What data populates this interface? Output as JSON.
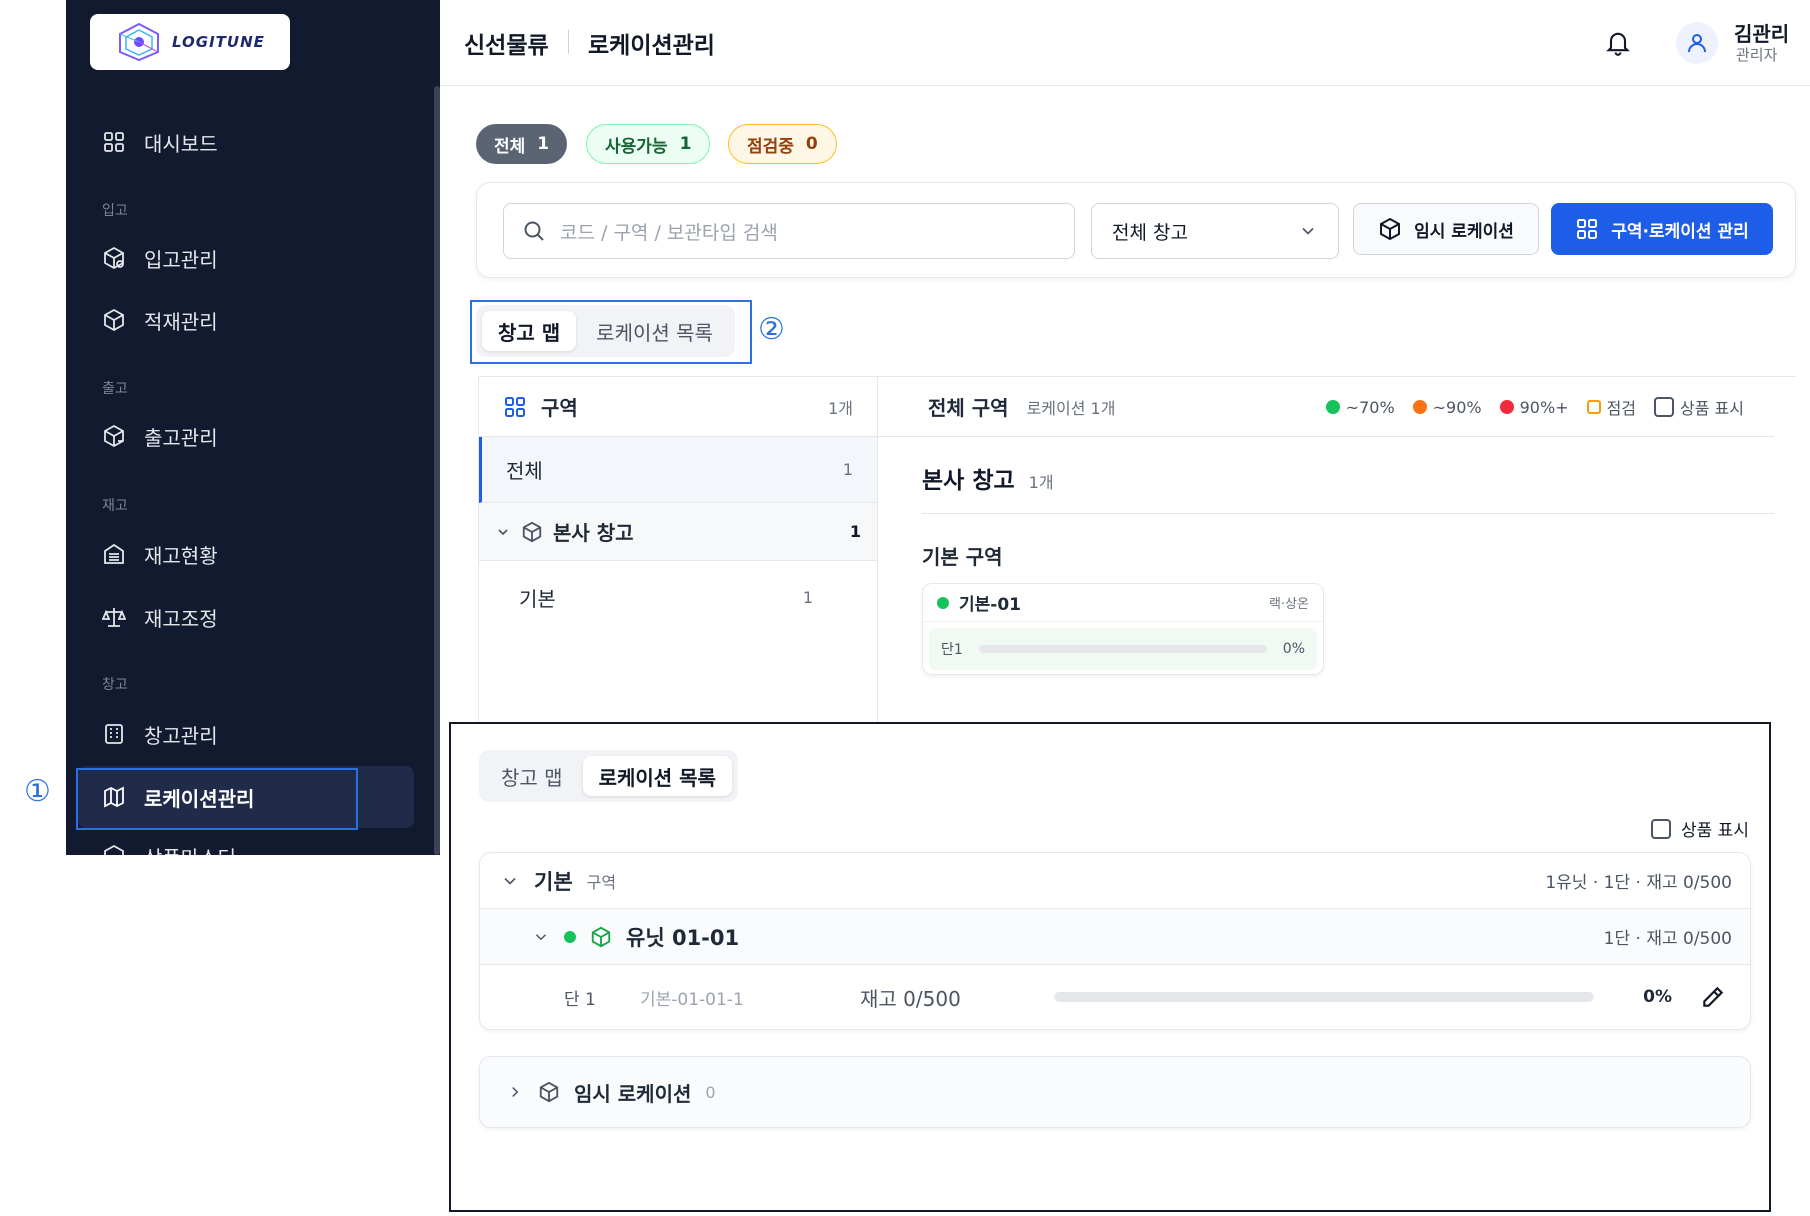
{
  "sidebar": {
    "logo_text": "LOGITUNE",
    "items": [
      {
        "label": "대시보드",
        "icon": "grid-icon"
      },
      {
        "group": "입고"
      },
      {
        "label": "입고관리",
        "icon": "box-in-icon"
      },
      {
        "label": "적재관리",
        "icon": "box-icon"
      },
      {
        "group": "출고"
      },
      {
        "label": "출고관리",
        "icon": "box-out-icon"
      },
      {
        "group": "재고"
      },
      {
        "label": "재고현황",
        "icon": "warehouse-icon"
      },
      {
        "label": "재고조정",
        "icon": "scale-icon"
      },
      {
        "group": "창고"
      },
      {
        "label": "창고관리",
        "icon": "building-icon"
      },
      {
        "label": "로케이션관리",
        "icon": "map-icon",
        "active": true
      },
      {
        "label": "상품마스터",
        "icon": "product-icon"
      }
    ],
    "markers": {
      "one": "①",
      "two": "②"
    }
  },
  "header": {
    "company": "신선물류",
    "page": "로케이션관리",
    "user_name": "김관리",
    "user_role": "관리자"
  },
  "chips": [
    {
      "label": "전체",
      "count": "1"
    },
    {
      "label": "사용가능",
      "count": "1"
    },
    {
      "label": "점검중",
      "count": "0"
    }
  ],
  "toolbar": {
    "search_placeholder": "코드 / 구역 / 보관타입 검색",
    "warehouse_select": "전체 창고",
    "temp_button": "임시 로케이션",
    "zone_button": "구역·로케이션 관리"
  },
  "tabs": [
    "창고 맵",
    "로케이션 목록"
  ],
  "zone_panel": {
    "title": "구역",
    "count": "1개",
    "rows": [
      {
        "label": "전체",
        "count": "1"
      },
      {
        "label": "본사 창고",
        "count": "1"
      },
      {
        "label": "기본",
        "count": "1"
      }
    ]
  },
  "map": {
    "title": "전체 구역",
    "subtitle": "로케이션 1개",
    "legend": [
      {
        "label": "~70%",
        "color": "#16c25a"
      },
      {
        "label": "~90%",
        "color": "#f97316"
      },
      {
        "label": "90%+",
        "color": "#ef2b3c"
      },
      {
        "label": "점검",
        "color": "#f59e0b"
      }
    ],
    "show_products": "상품 표시",
    "warehouse": "본사 창고",
    "warehouse_count": "1개",
    "zone": "기본 구역",
    "card": {
      "code": "기본-01",
      "tag": "랙·상온",
      "level": "단1",
      "percent": "0%",
      "fill": 0
    }
  },
  "list": {
    "show_products": "상품 표시",
    "zone_name": "기본",
    "zone_type": "구역",
    "zone_meta": "1유닛 · 1단 · 재고 0/500",
    "unit_name": "유닛 01-01",
    "unit_meta": "1단 · 재고 0/500",
    "level": {
      "name": "단 1",
      "code": "기본-01-01-1",
      "stock": "재고 0/500",
      "percent": "0%",
      "fill": 0
    },
    "temp_name": "임시 로케이션",
    "temp_count": "0"
  }
}
